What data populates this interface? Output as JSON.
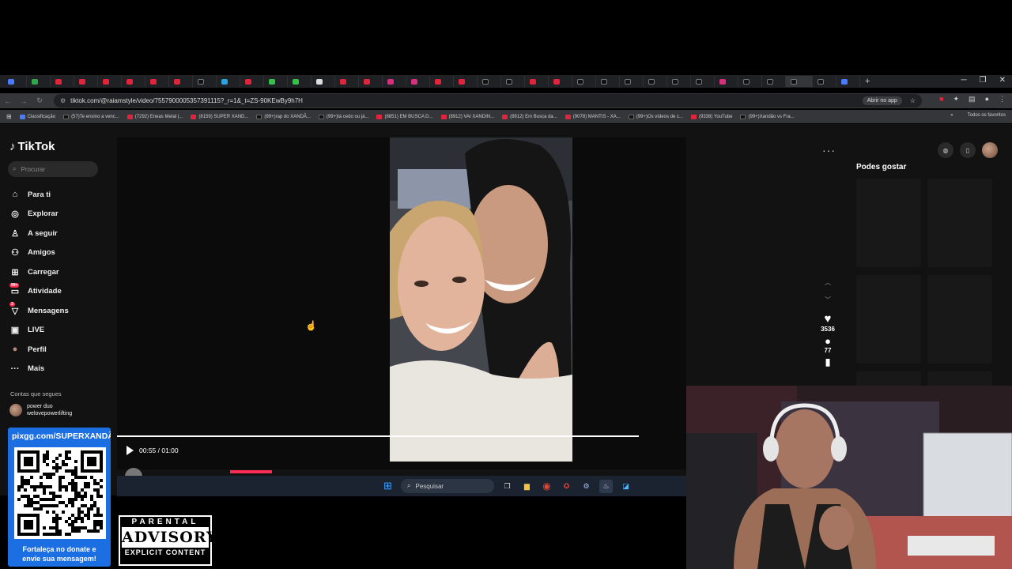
{
  "browser": {
    "url": "tiktok.com/@raiamstyle/video/7557900005357391115?_r=1&_t=ZS-90KEwBy9h7H",
    "open_app_label": "Abrir no app",
    "tab_count": 40,
    "bookmarks": [
      {
        "label": "Classificação",
        "kind": "other"
      },
      {
        "label": "(57)Te ensino a venc...",
        "kind": "tt"
      },
      {
        "label": "(7292) Eneas Metal |...",
        "kind": "yt"
      },
      {
        "label": "(8159) SUPER XAND...",
        "kind": "yt"
      },
      {
        "label": "(99+)rap do XANDÃ...",
        "kind": "tt"
      },
      {
        "label": "(99+)tá cedo ou já...",
        "kind": "tt"
      },
      {
        "label": "(8851) EM BUSCA D...",
        "kind": "yt"
      },
      {
        "label": "(8912) VAI XANDIN...",
        "kind": "yt"
      },
      {
        "label": "(8912) Em Busca da...",
        "kind": "yt"
      },
      {
        "label": "(9078) MANTIS - XA...",
        "kind": "yt"
      },
      {
        "label": "(99+)Os vídeos de c...",
        "kind": "tt"
      },
      {
        "label": "(9338) YouTube",
        "kind": "yt"
      },
      {
        "label": "(99+)Xandão vs Fra...",
        "kind": "tt"
      }
    ],
    "all_bookmarks_label": "Todos os favoritos"
  },
  "tiktok": {
    "logo": "TikTok",
    "search_placeholder": "Procurar",
    "nav": [
      {
        "label": "Para ti",
        "icon": "home-icon",
        "glyph": "⌂"
      },
      {
        "label": "Explorar",
        "icon": "compass-icon",
        "glyph": "◎"
      },
      {
        "label": "A seguir",
        "icon": "following-icon",
        "glyph": "♙"
      },
      {
        "label": "Amigos",
        "icon": "friends-icon",
        "glyph": "⚇"
      },
      {
        "label": "Carregar",
        "icon": "upload-icon",
        "glyph": "⊞"
      },
      {
        "label": "Atividade",
        "icon": "inbox-icon",
        "glyph": "▭",
        "badge": "99+"
      },
      {
        "label": "Mensagens",
        "icon": "messages-icon",
        "glyph": "▽",
        "badge": "3"
      },
      {
        "label": "LIVE",
        "icon": "live-icon",
        "glyph": "▣"
      },
      {
        "label": "Perfil",
        "icon": "profile-avatar-icon",
        "glyph": "●"
      },
      {
        "label": "Mais",
        "icon": "more-icon",
        "glyph": "···"
      }
    ],
    "following_title": "Contas que segues",
    "following": [
      {
        "name": "power duo",
        "handle": "welovepowerlifting"
      }
    ],
    "player": {
      "time": "00:55 / 01:00",
      "progress": 0.917,
      "author": "raiamstyle",
      "likes": "3536",
      "comments": "77"
    },
    "might_like_title": "Podes gostar"
  },
  "taskbar": {
    "search_placeholder": "Pesquisar"
  },
  "overlay": {
    "donate_url": "pixgg.com/SUPERXANDÃO",
    "donate_msg_line1": "Fortaleça no donate e",
    "donate_msg_line2": "envie sua mensagem!",
    "advisory_top": "PARENTAL",
    "advisory_mid": "ADVISORY",
    "advisory_bot": "EXPLICIT CONTENT"
  },
  "colors": {
    "tiktok_accent": "#fe2c55",
    "donate_blue": "#1c6fe3",
    "taskbar": "#1b2330"
  }
}
